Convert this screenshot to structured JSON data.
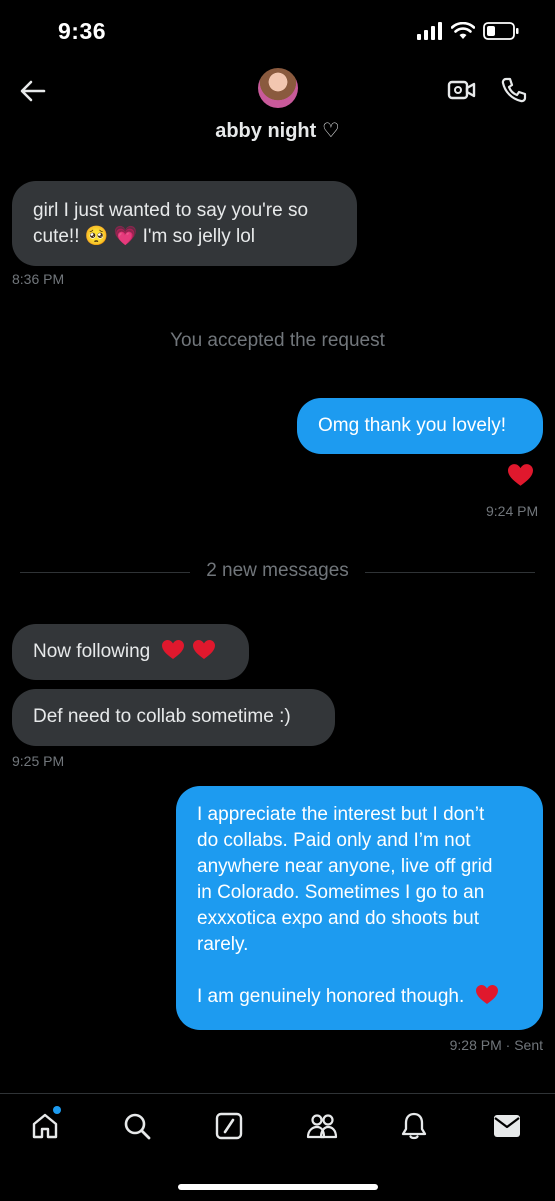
{
  "status_bar": {
    "time": "9:36"
  },
  "header": {
    "contact_name": "abby night ♡"
  },
  "messages": {
    "m1": {
      "text": "girl I just wanted to say you're so\ncute!! 🥺 💗 I'm so jelly lol",
      "time": "8:36 PM"
    },
    "system_note": "You accepted the request",
    "m2": {
      "text": "Omg thank you lovely!",
      "reaction": "❤️",
      "time": "9:24 PM"
    },
    "divider": "2 new messages",
    "m3": {
      "text": "Now following"
    },
    "m4": {
      "text": "Def need to collab sometime :)",
      "time": "9:25 PM"
    },
    "m5": {
      "text": "I appreciate the interest but I don’t\ndo collabs. Paid only and I’m not\nanywhere near anyone, live off grid\nin Colorado. Sometimes I go to an\nexxxotica expo and do shoots but\nrarely.\n\nI am genuinely honored though.",
      "time": "9:28 PM",
      "status": "· Sent"
    }
  },
  "tab_bar": {
    "items": [
      "home-icon",
      "search-icon",
      "compose-icon",
      "communities-icon",
      "notifications-icon",
      "messages-icon"
    ],
    "home_has_badge": true
  },
  "colors": {
    "accent": "#1d9bf0",
    "incoming_bubble": "#333639",
    "background": "#000000",
    "muted": "#71767b"
  }
}
